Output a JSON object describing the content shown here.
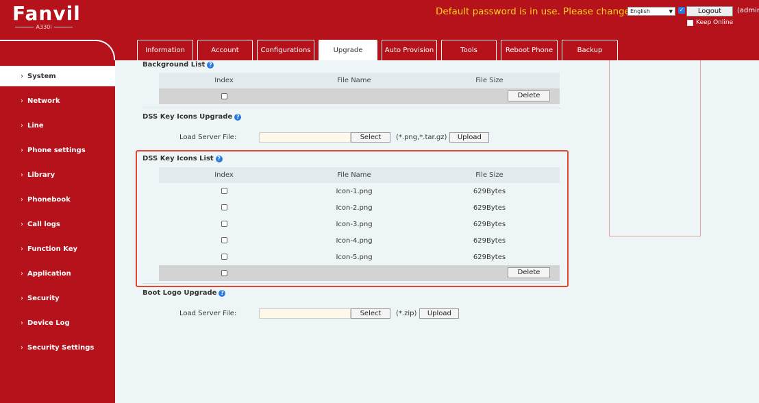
{
  "header": {
    "logo": {
      "word": "Fanvil",
      "model": "A330i"
    },
    "warning": "Default password is in use. Please change",
    "language": "English",
    "logout_label": "Logout",
    "admin_label": "(admin",
    "keep_online_label": "Keep Online"
  },
  "tabs": [
    {
      "label": "Information",
      "active": false
    },
    {
      "label": "Account",
      "active": false
    },
    {
      "label": "Configurations",
      "active": false
    },
    {
      "label": "Upgrade",
      "active": true
    },
    {
      "label": "Auto Provision",
      "active": false
    },
    {
      "label": "Tools",
      "active": false
    },
    {
      "label": "Reboot Phone",
      "active": false
    },
    {
      "label": "Backup",
      "active": false
    }
  ],
  "sidebar": {
    "items": [
      {
        "label": "System",
        "active": true
      },
      {
        "label": "Network"
      },
      {
        "label": "Line"
      },
      {
        "label": "Phone settings"
      },
      {
        "label": "Library"
      },
      {
        "label": "Phonebook"
      },
      {
        "label": "Call logs"
      },
      {
        "label": "Function Key"
      },
      {
        "label": "Application"
      },
      {
        "label": "Security"
      },
      {
        "label": "Device Log"
      },
      {
        "label": "Security Settings"
      }
    ]
  },
  "content": {
    "background_list": {
      "title": "Background List",
      "columns": {
        "index": "Index",
        "name": "File Name",
        "size": "File Size"
      },
      "delete_label": "Delete"
    },
    "dss_upgrade": {
      "title": "DSS Key Icons Upgrade",
      "load_label": "Load Server File:",
      "select_label": "Select",
      "hint": "(*.png,*.tar.gz)",
      "upload_label": "Upload"
    },
    "dss_list": {
      "title": "DSS Key Icons List",
      "columns": {
        "index": "Index",
        "name": "File Name",
        "size": "File Size"
      },
      "rows": [
        {
          "name": "Icon-1.png",
          "size": "629Bytes"
        },
        {
          "name": "Icon-2.png",
          "size": "629Bytes"
        },
        {
          "name": "Icon-3.png",
          "size": "629Bytes"
        },
        {
          "name": "Icon-4.png",
          "size": "629Bytes"
        },
        {
          "name": "Icon-5.png",
          "size": "629Bytes"
        }
      ],
      "delete_label": "Delete"
    },
    "boot_logo": {
      "title": "Boot Logo Upgrade",
      "load_label": "Load Server File:",
      "select_label": "Select",
      "hint": "(*.zip)",
      "upload_label": "Upload"
    }
  },
  "colors": {
    "brand": "#b5121b",
    "warning": "#ffd21a",
    "highlight": "#e0472b",
    "help": "#2a7ae2"
  }
}
